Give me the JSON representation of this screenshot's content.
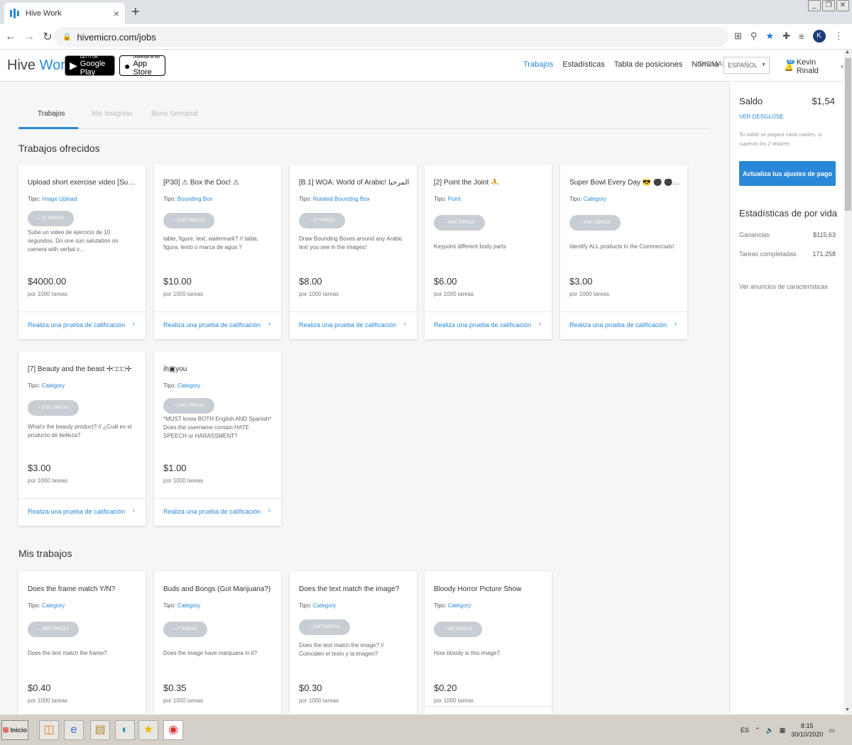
{
  "browser": {
    "tab_title": "Hive Work",
    "tab_close": "×",
    "new_tab": "+",
    "url": "hivemicro.com/jobs",
    "profile_initial": "K"
  },
  "header": {
    "logo_prefix": "Hive ",
    "logo_accent": "Work",
    "google_play_small": "GET IT ON",
    "google_play_big": "Google Play",
    "app_store_small": "Download on the",
    "app_store_big": "App Store",
    "nav": [
      "Trabajos",
      "Estadísticas",
      "Tabla de posiciones",
      "Nómina"
    ],
    "language_label": "IDIOMA:",
    "language_value": "ESPAÑOL",
    "notification_count": "10",
    "user_name": "Kevin Rinald"
  },
  "subtabs": [
    "Trabajos",
    "Mis Insignias",
    "Bono Semanal"
  ],
  "sections": {
    "offered": "Trabajos ofrecidos",
    "mine": "Mis trabajos"
  },
  "labels": {
    "type_prefix": "Tipo: ",
    "per_1000": "por 1000 tareas",
    "cta": "Realiza una prueba de calificación"
  },
  "offered_jobs": [
    {
      "title": "Upload short exercise video [Sun Salut...",
      "type": "Image Upload",
      "tasks": "~ 10 TAREAS",
      "desc": "Sube un video de ejercicio de 10 segundos. Do one sun salutation on camera with verbal c...",
      "price": "$4000.00"
    },
    {
      "title": "[P30] ⚠ Box the Doc! ⚠",
      "type": "Bounding Box",
      "tasks": "~ 1000 TAREAS",
      "desc": "table, figure, text, watermark? // tabla, figura, texto o marca de agua ?",
      "price": "$10.00"
    },
    {
      "title": "[B.1] WOA: World of Arabic! المرحبا",
      "type": "Rotated Bounding Box",
      "tasks": "~ 10 TAREAS",
      "desc": "Draw Bounding Boxes around any Arabic text you see in the images!",
      "price": "$8.00"
    },
    {
      "title": "[2] Point the Joint ⛹",
      "type": "Point",
      "tasks": "~ 4000 TAREAS",
      "desc": "Keypoint different body parts",
      "price": "$6.00"
    },
    {
      "title": "Super Bowl Every Day 😎 ⚫ ⚫ - Watchi...",
      "type": "Category",
      "tasks": "~ 3140 TAREAS",
      "desc": "Identify ALL products in the Commercials!",
      "price": "$3.00"
    },
    {
      "title": "[7] Beauty and the beast ✢□□□✢",
      "type": "Category",
      "tasks": "~ 2010 TAREAS",
      "desc": "What's the beauty product? // ¿Cuál es el producto de belleza?",
      "price": "$3.00"
    },
    {
      "title": "ih▣you",
      "type": "Category",
      "tasks": "~ 2000 TAREAS",
      "desc": "*MUST know BOTH English AND Spanish* Does the username contain HATE SPEECH or HARASSMENT?",
      "price": "$1.00"
    }
  ],
  "my_jobs": [
    {
      "title": "Does the frame match Y/N?",
      "type": "Category",
      "tasks": "~ 1990 TAREAS",
      "desc": "Does the text match the frame?",
      "price": "$0.40"
    },
    {
      "title": "Buds and Bongs (Got Marijuana?)",
      "type": "Category",
      "tasks": "~ 0 TAREAS",
      "desc": "Does the image have marijuana in it?",
      "price": "$0.35"
    },
    {
      "title": "Does the text match the image?",
      "type": "Category",
      "tasks": "~ 1940 TAREAS",
      "desc": "Does the text match the image? // Coinciden el texto y la imagen?",
      "price": "$0.30"
    },
    {
      "title": "Bloody Horror Picture Show",
      "type": "Category",
      "tasks": "~ 980 TAREAS",
      "desc": "How bloody is this image?",
      "price": "$0.20"
    }
  ],
  "panel": {
    "balance_label": "Saldo",
    "balance_value": "$1,54",
    "breakdown_link": "VER DESGLOSE",
    "note": "Tu saldo se pagará cada martes, si superas los 2 dólares",
    "update_button": "Actualiza tus ajustes de pago",
    "stats_title": "Estadísticas de por vida",
    "earnings_label": "Ganancias",
    "earnings_value": "$115,63",
    "tasks_label": "Tareas completadas",
    "tasks_value": "171.258",
    "features_link": "Ver anuncios de características"
  },
  "taskbar": {
    "start": "Inicio",
    "lang": "ES",
    "time": "8:15",
    "date": "30/10/2020"
  },
  "colors": {
    "accent": "#2a88d8",
    "pill": "#c8cdd4"
  }
}
